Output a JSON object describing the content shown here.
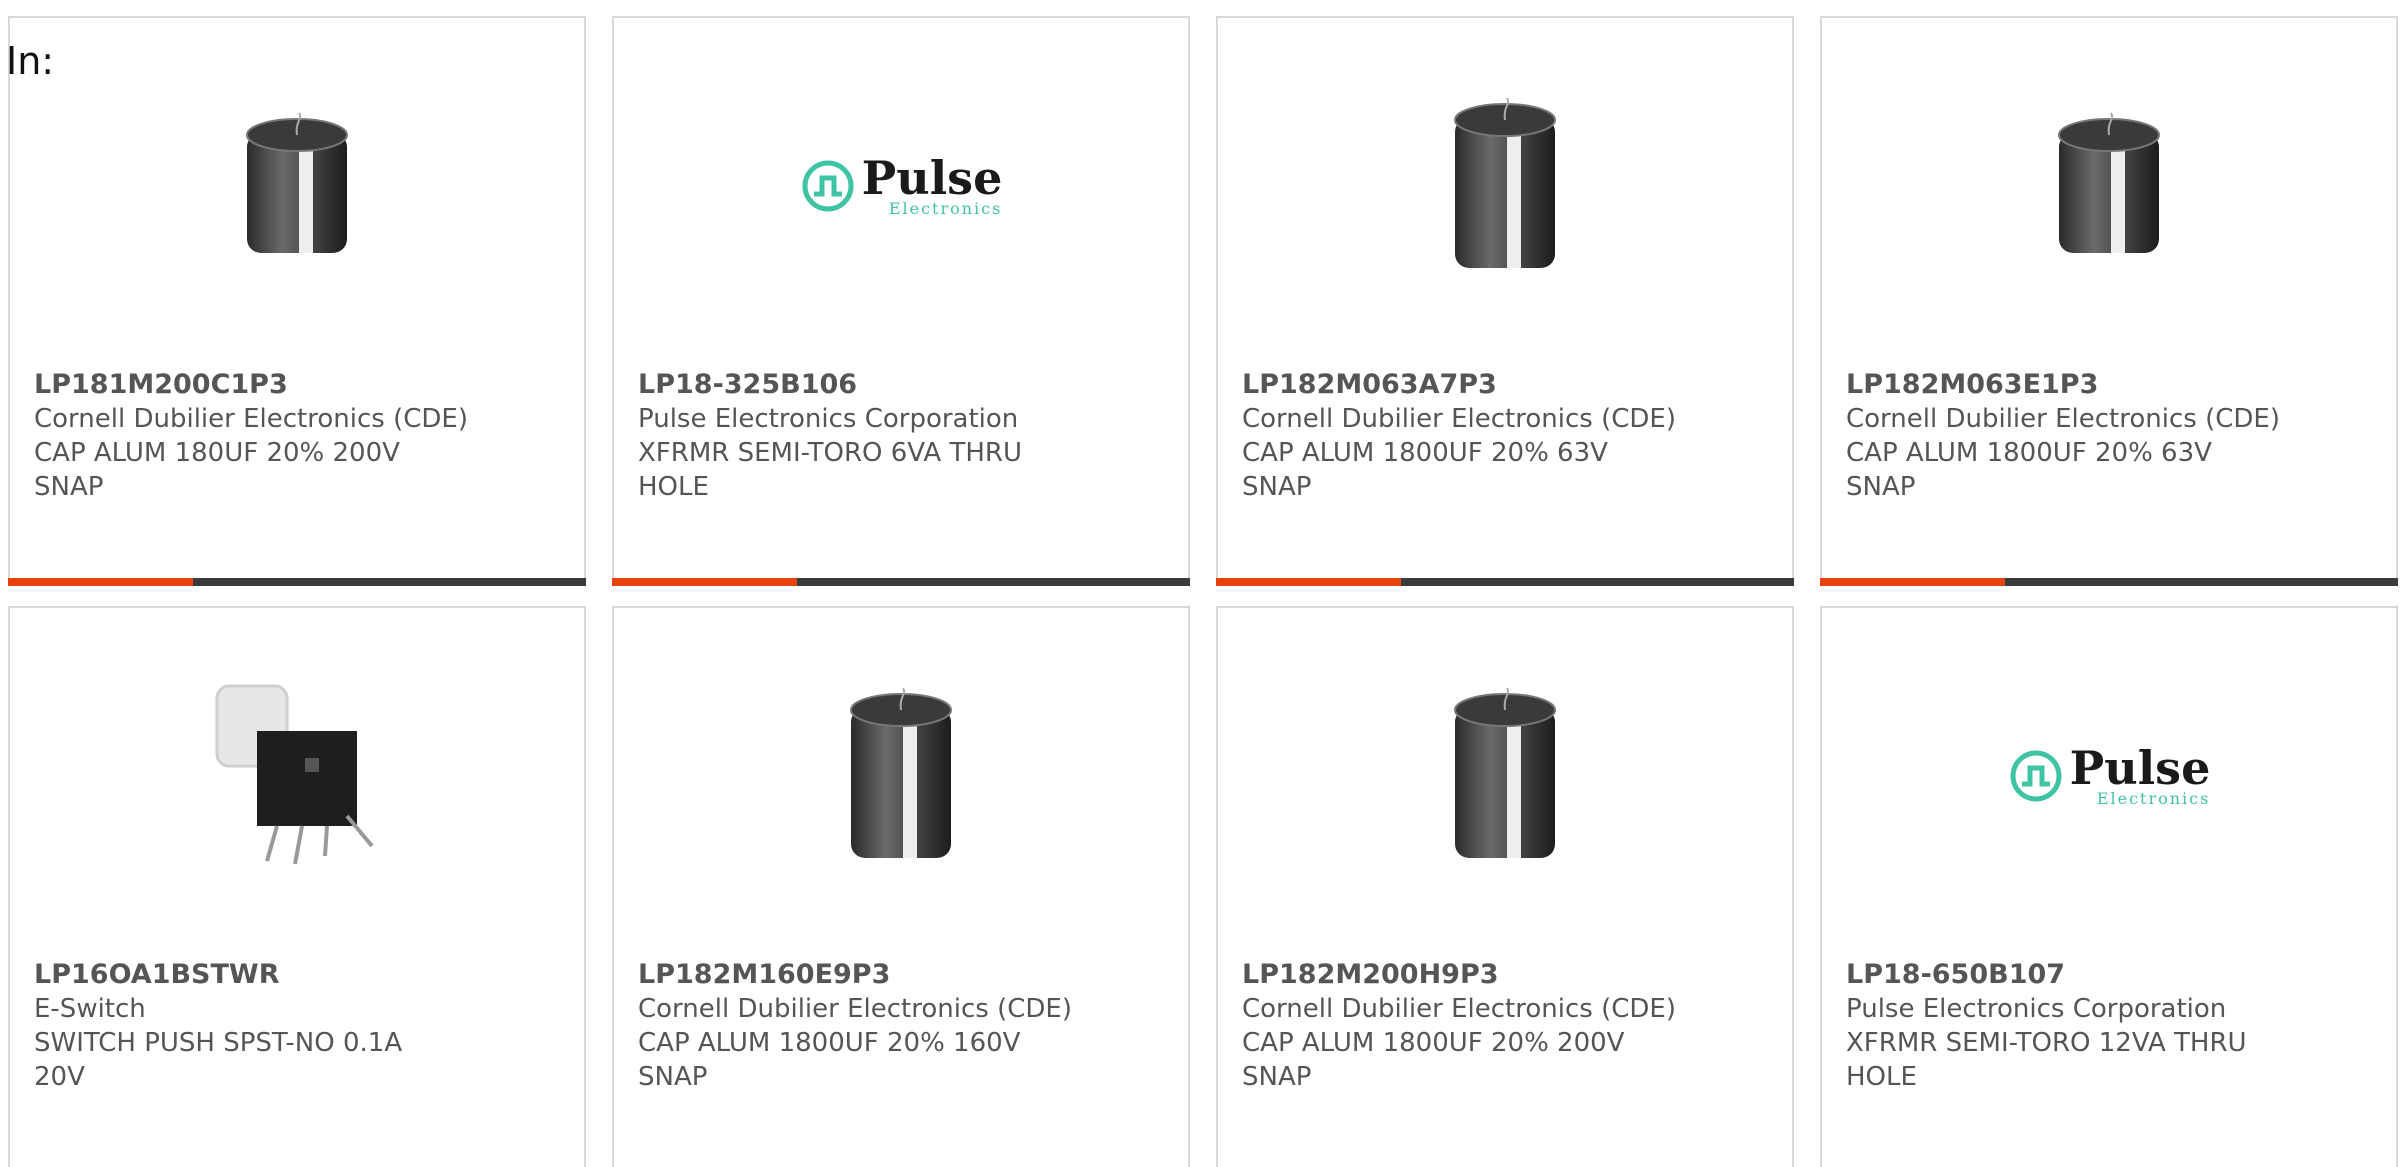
{
  "in_label": "In:",
  "colors": {
    "accent": "#e8420f",
    "bar_dark": "#3a3a3a",
    "text": "#555555",
    "border": "#d9d9d9",
    "pulse_teal": "#3fc3a5"
  },
  "products": [
    {
      "part_number": "LP181M200C1P3",
      "manufacturer": "Cornell Dubilier Electronics (CDE)",
      "description": "CAP ALUM 180UF 20% 200V SNAP",
      "image_icon": "capacitor-short-icon",
      "progress": 0.32
    },
    {
      "part_number": "LP18-325B106",
      "manufacturer": "Pulse Electronics Corporation",
      "description": "XFRMR SEMI-TORO 6VA THRU HOLE",
      "image_icon": "pulse-logo",
      "logo_text": "Pulse",
      "logo_sub": "Electronics",
      "progress": 0.32
    },
    {
      "part_number": "LP182M063A7P3",
      "manufacturer": "Cornell Dubilier Electronics (CDE)",
      "description": "CAP ALUM 1800UF 20% 63V SNAP",
      "image_icon": "capacitor-tall-icon",
      "progress": 0.32
    },
    {
      "part_number": "LP182M063E1P3",
      "manufacturer": "Cornell Dubilier Electronics (CDE)",
      "description": "CAP ALUM 1800UF 20% 63V SNAP",
      "image_icon": "capacitor-short-icon",
      "progress": 0.32
    },
    {
      "part_number": "LP16OA1BSTWR",
      "manufacturer": "E-Switch",
      "description": "SWITCH PUSH SPST-NO 0.1A 20V",
      "image_icon": "push-switch-icon"
    },
    {
      "part_number": "LP182M160E9P3",
      "manufacturer": "Cornell Dubilier Electronics (CDE)",
      "description": "CAP ALUM 1800UF 20% 160V SNAP",
      "image_icon": "capacitor-tall-icon"
    },
    {
      "part_number": "LP182M200H9P3",
      "manufacturer": "Cornell Dubilier Electronics (CDE)",
      "description": "CAP ALUM 1800UF 20% 200V SNAP",
      "image_icon": "capacitor-tall-icon"
    },
    {
      "part_number": "LP18-650B107",
      "manufacturer": "Pulse Electronics Corporation",
      "description": "XFRMR SEMI-TORO 12VA THRU HOLE",
      "image_icon": "pulse-logo",
      "logo_text": "Pulse",
      "logo_sub": "Electronics"
    }
  ]
}
